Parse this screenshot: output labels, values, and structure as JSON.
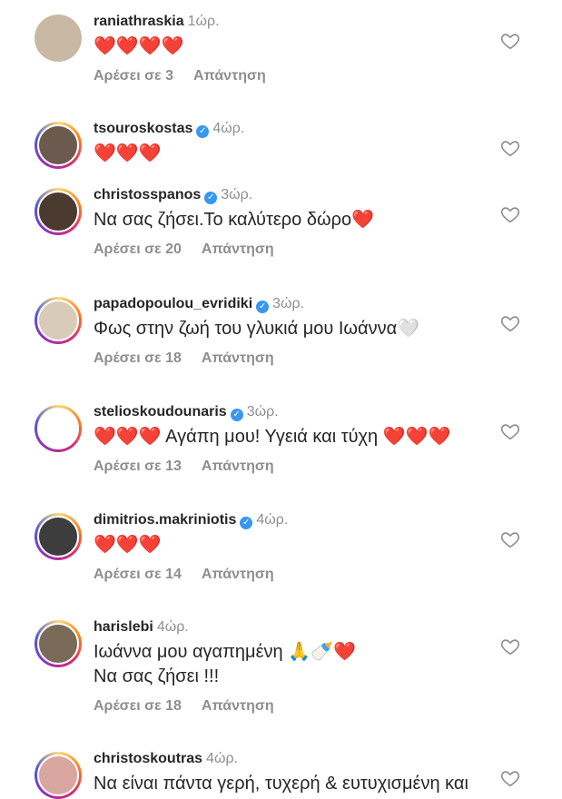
{
  "comments": [
    {
      "user": "raniathraskia",
      "verified": false,
      "time": "1ώρ.",
      "lines": [
        "❤️❤️❤️❤️"
      ],
      "likes": "Αρέσει σε 3",
      "reply": "Απάντηση",
      "avatar_color": "#c9b8a3",
      "ring": false
    },
    {
      "user": "tsouroskostas",
      "verified": true,
      "time": "4ώρ.",
      "lines": [
        "❤️❤️❤️"
      ],
      "likes": "",
      "reply": "",
      "avatar_color": "#6b5a4e",
      "ring": true
    },
    {
      "user": "christosspanos",
      "verified": true,
      "time": "3ώρ.",
      "lines": [
        "Να σας ζήσει.Το καλύτερο δώρο❤️"
      ],
      "likes": "Αρέσει σε 20",
      "reply": "Απάντηση",
      "avatar_color": "#4a3a30",
      "ring": true
    },
    {
      "user": "papadopoulou_evridiki",
      "verified": true,
      "time": "3ώρ.",
      "lines": [
        "Φως στην ζωή του γλυκιά μου Ιωάννα🤍"
      ],
      "likes": "Αρέσει σε 18",
      "reply": "Απάντηση",
      "avatar_color": "#d8cbb8",
      "ring": true
    },
    {
      "user": "stelioskoudounaris",
      "verified": true,
      "time": "3ώρ.",
      "lines": [
        "❤️❤️❤️ Αγάπη μου! Υγειά και τύχη ❤️❤️❤️"
      ],
      "likes": "Αρέσει σε 13",
      "reply": "Απάντηση",
      "avatar_color": "#ffffff",
      "ring": true
    },
    {
      "user": "dimitrios.makriniotis",
      "verified": true,
      "time": "4ώρ.",
      "lines": [
        "❤️❤️❤️"
      ],
      "likes": "Αρέσει σε 14",
      "reply": "Απάντηση",
      "avatar_color": "#3d3d3d",
      "ring": true
    },
    {
      "user": "harislebi",
      "verified": false,
      "time": "4ώρ.",
      "lines": [
        "Ιωάννα μου αγαπημένη 🙏🍼❤️",
        "Να σας ζήσει !!!"
      ],
      "likes": "Αρέσει σε 18",
      "reply": "Απάντηση",
      "avatar_color": "#7a6a58",
      "ring": true
    },
    {
      "user": "christoskoutras",
      "verified": false,
      "time": "4ώρ.",
      "lines": [
        "Να είναι πάντα γερή, τυχερή & ευτυχισμένη και"
      ],
      "likes": "",
      "reply": "",
      "avatar_color": "#d9a6a0",
      "ring": true
    }
  ],
  "icons": {
    "like": "heart-outline-icon",
    "verified": "verified-badge-icon"
  },
  "colors": {
    "heart": "#ed4956",
    "verified": "#3897f0",
    "muted": "#8e8e8e"
  }
}
